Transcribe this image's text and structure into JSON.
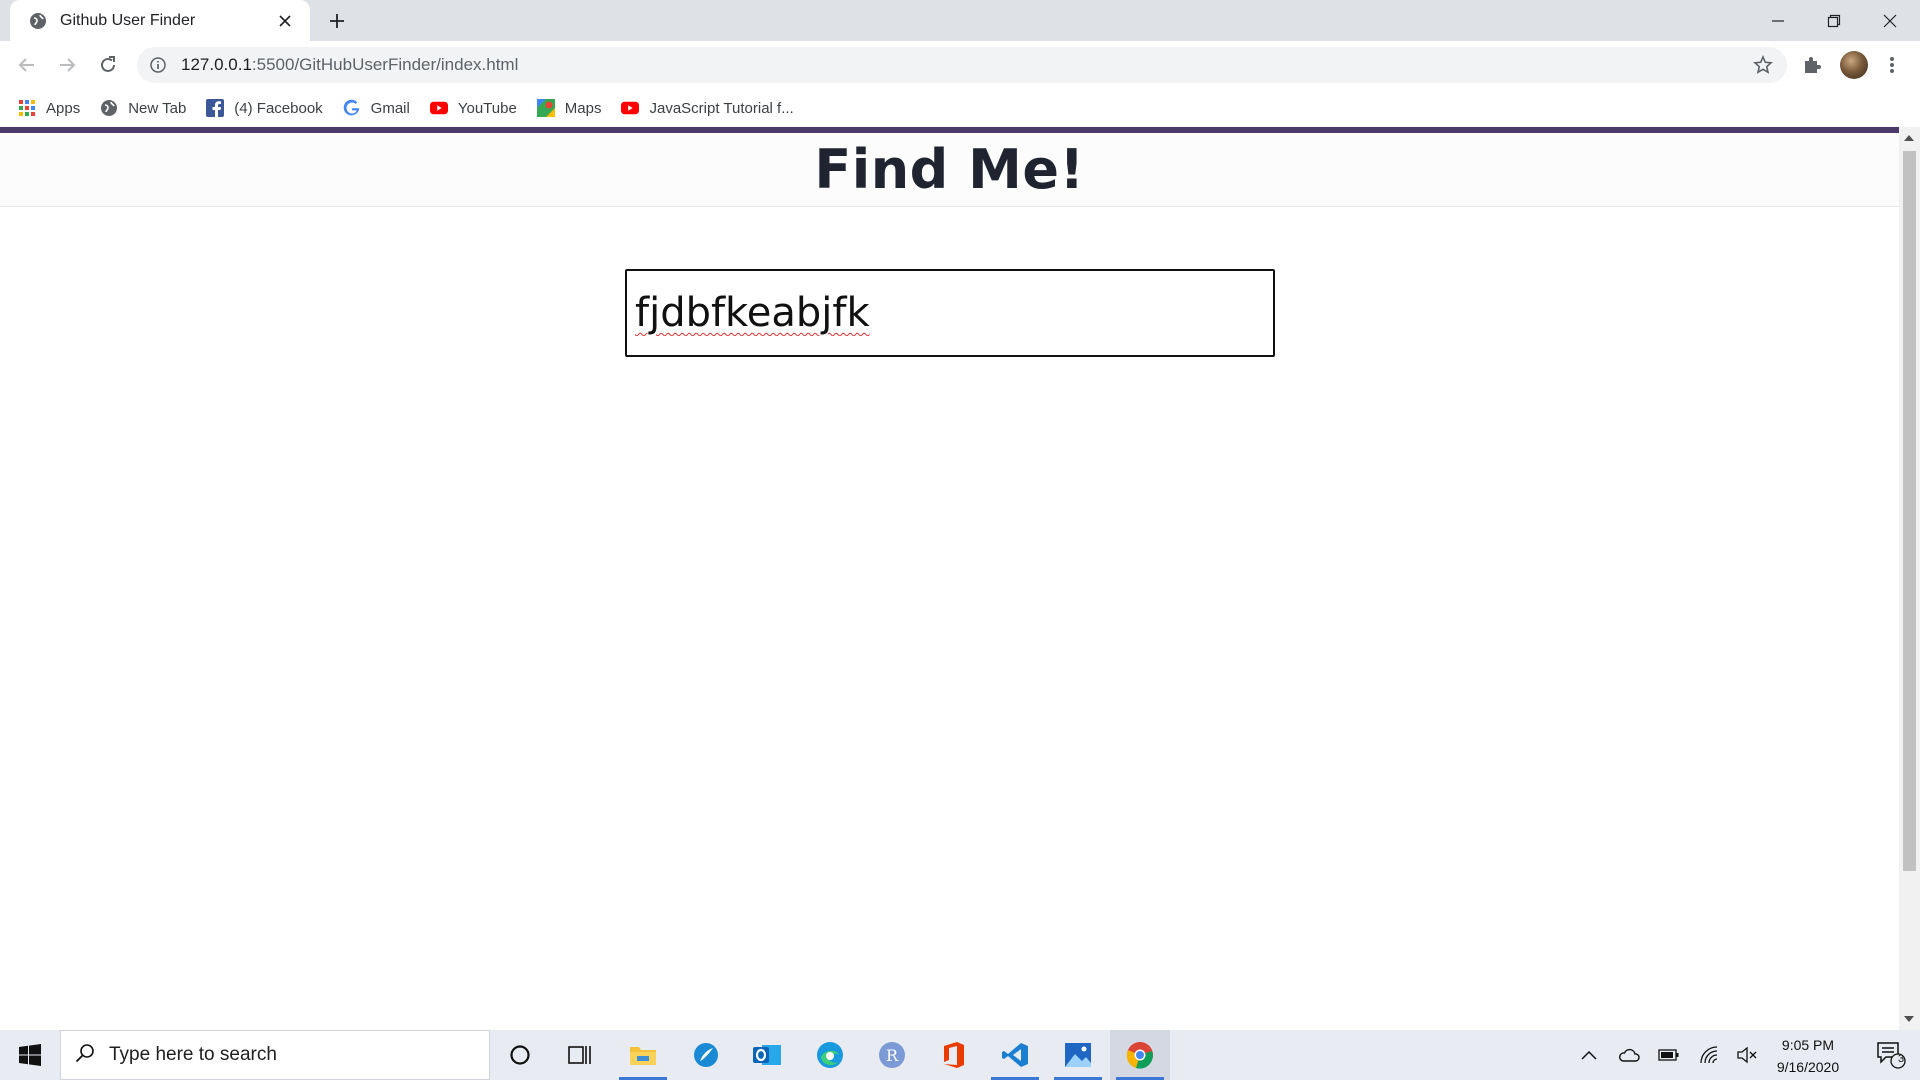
{
  "browser": {
    "tab_title": "Github User Finder",
    "url_host": "127.0.0.1",
    "url_rest": ":5500/GitHubUserFinder/index.html",
    "bookmarks": [
      "Apps",
      "New Tab",
      "(4) Facebook",
      "Gmail",
      "YouTube",
      "Maps",
      "JavaScript Tutorial f..."
    ]
  },
  "page": {
    "title": "Find Me!",
    "search_value": "fjdbfkeabjfk"
  },
  "taskbar": {
    "search_placeholder": "Type here to search",
    "time": "9:05 PM",
    "date": "9/16/2020",
    "notification_count": "3"
  },
  "colors": {
    "accent_bar": "#4a3b6b",
    "taskbar_active": "#3b78d6"
  }
}
